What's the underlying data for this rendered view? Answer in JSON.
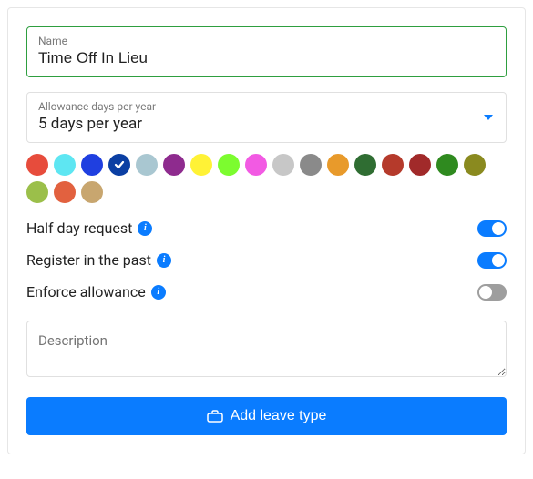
{
  "name_field": {
    "label": "Name",
    "value": "Time Off In Lieu"
  },
  "allowance_field": {
    "label": "Allowance days per year",
    "value": "5 days per year"
  },
  "color_swatches": [
    {
      "hex": "#e74c3c",
      "selected": false
    },
    {
      "hex": "#5ee6f2",
      "selected": false
    },
    {
      "hex": "#1f3fe0",
      "selected": false
    },
    {
      "hex": "#0b3fa3",
      "selected": true
    },
    {
      "hex": "#a9c7d1",
      "selected": false
    },
    {
      "hex": "#8e2b8e",
      "selected": false
    },
    {
      "hex": "#fff236",
      "selected": false
    },
    {
      "hex": "#7cfc2f",
      "selected": false
    },
    {
      "hex": "#f25ae3",
      "selected": false
    },
    {
      "hex": "#c7c7c7",
      "selected": false
    },
    {
      "hex": "#8a8a8a",
      "selected": false
    },
    {
      "hex": "#e89a2b",
      "selected": false
    },
    {
      "hex": "#2f6d32",
      "selected": false
    },
    {
      "hex": "#b53a2b",
      "selected": false
    },
    {
      "hex": "#a12a2a",
      "selected": false
    },
    {
      "hex": "#2f8a1f",
      "selected": false
    },
    {
      "hex": "#8a8a1f",
      "selected": false
    },
    {
      "hex": "#9bbf4a",
      "selected": false
    },
    {
      "hex": "#e2613f",
      "selected": false
    },
    {
      "hex": "#c8a66f",
      "selected": false
    }
  ],
  "toggles": {
    "half_day": {
      "label": "Half day request",
      "on": true
    },
    "register_past": {
      "label": "Register in the past",
      "on": true
    },
    "enforce_allowance": {
      "label": "Enforce allowance",
      "on": false
    }
  },
  "description": {
    "placeholder": "Description",
    "value": ""
  },
  "submit": {
    "label": "Add leave type"
  }
}
